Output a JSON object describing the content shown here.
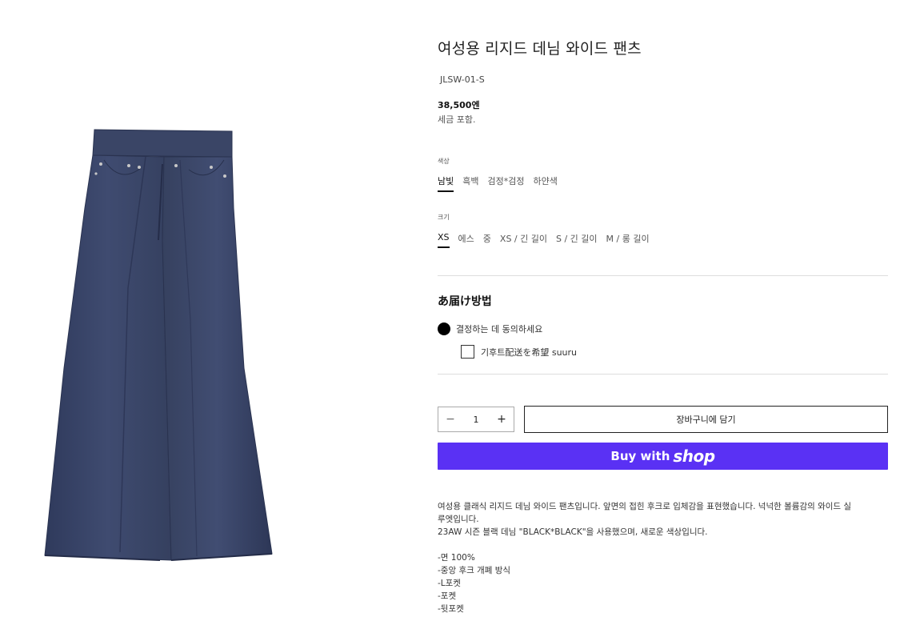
{
  "product": {
    "title": "여성용 리지드 데님 와이드 팬츠",
    "sku": "JLSW-01-S",
    "price": "38,500엔",
    "tax_note": "세금 포함.",
    "image_icon": "denim-wide-pants-image",
    "colors": {
      "primary": "#3b4668",
      "seam": "#2c3553",
      "button_brand": "#5a31f4"
    }
  },
  "options": {
    "color": {
      "label": "색상",
      "values": [
        "남빛",
        "흑백",
        "검정*검정",
        "하얀색"
      ],
      "selected": "남빛"
    },
    "size": {
      "label": "크기",
      "values": [
        "XS",
        "에스",
        "중",
        "XS / 긴 길이",
        "S / 긴 길이",
        "M / 롱 길이"
      ],
      "selected": "XS"
    }
  },
  "delivery": {
    "title": "あ届け방법",
    "radio_label": "결정하는 데 동의하세요",
    "checkbox_label": "기후트配送を希望 suuru"
  },
  "cart": {
    "quantity": "1",
    "minus": "−",
    "plus": "+",
    "add_to_cart": "장바구니에 담기",
    "buy_with": "Buy with",
    "shop_brand": "shop"
  },
  "description": {
    "lines": [
      "여성용 클래식 리지드 데님 와이드 팬츠입니다. 앞면의 접힌 후크로 입체감을 표현했습니다. 넉넉한 볼륨감의 와이드 실",
      "루엣입니다.",
      "23AW 시즌 블랙 데님 \"BLACK*BLACK\"을 사용했으며, 새로운 색상입니다."
    ],
    "features": [
      "-면 100%",
      "-중앙 후크 개폐 방식",
      "-L포켓",
      "-포켓",
      "-뒷포켓"
    ]
  }
}
